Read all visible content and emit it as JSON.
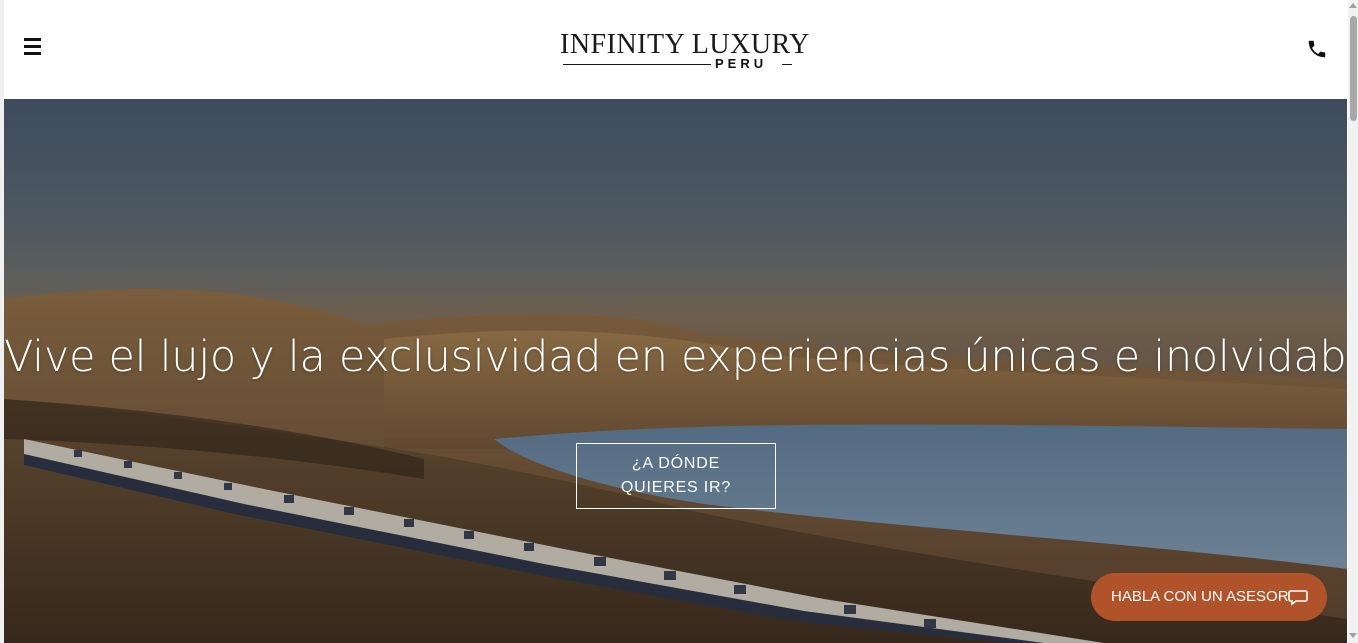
{
  "header": {
    "menu_icon": "hamburger-menu-icon",
    "logo_main": "INFINITY LUXURY",
    "logo_sub": "PERU",
    "phone_icon": "phone-icon"
  },
  "hero": {
    "headline": "Vive el lujo y la exclusividad en experiencias únicas e inolvidables",
    "cta_line1": "¿A DÓNDE",
    "cta_line2": "QUIERES IR?",
    "background": "train-along-lake-landscape"
  },
  "advisor_button": {
    "label": "HABLA CON UN ASESOR",
    "icon": "chat-bubble-icon"
  },
  "colors": {
    "advisor_bg": "#b0532a",
    "text_dark": "#111111",
    "text_light": "#ffffff"
  }
}
